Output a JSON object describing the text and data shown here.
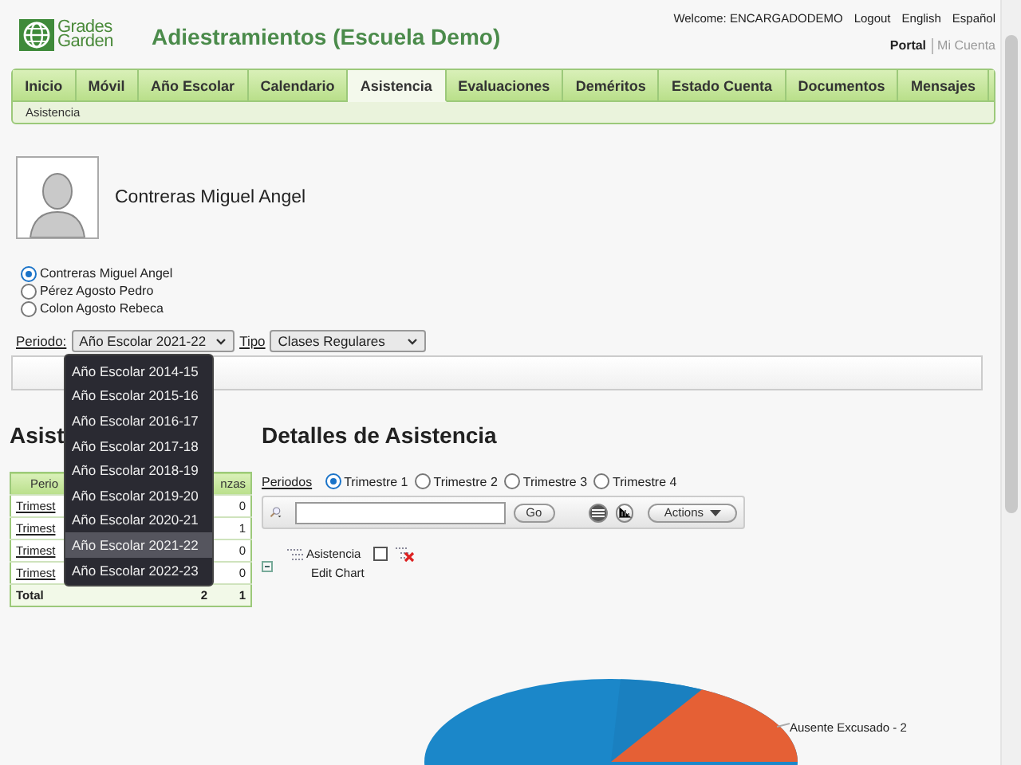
{
  "header": {
    "logo_text": [
      "Grades",
      "Garden"
    ],
    "title": "Adiestramientos (Escuela Demo)",
    "welcome": "Welcome: ENCARGADODEMO",
    "links": [
      "Logout",
      "English",
      "Español"
    ],
    "portal": [
      {
        "label": "Portal",
        "selected": true
      },
      {
        "label": "Mi Cuenta",
        "selected": false
      }
    ]
  },
  "tabs": [
    {
      "label": "Inicio",
      "selected": false
    },
    {
      "label": "Móvil",
      "selected": false
    },
    {
      "label": "Año Escolar",
      "selected": false
    },
    {
      "label": "Calendario",
      "selected": false
    },
    {
      "label": "Asistencia",
      "selected": true
    },
    {
      "label": "Evaluaciones",
      "selected": false
    },
    {
      "label": "Deméritos",
      "selected": false
    },
    {
      "label": "Estado Cuenta",
      "selected": false
    },
    {
      "label": "Documentos",
      "selected": false
    },
    {
      "label": "Mensajes",
      "selected": false
    }
  ],
  "breadcrumb": "Asistencia",
  "student": {
    "name": "Contreras Miguel Angel"
  },
  "students": [
    {
      "label": "Contreras Miguel Angel",
      "selected": true
    },
    {
      "label": "Pérez Agosto Pedro",
      "selected": false
    },
    {
      "label": "Colon Agosto Rebeca",
      "selected": false
    }
  ],
  "filters": {
    "period_label": "Periodo:",
    "period_value": "Año Escolar 2021-22",
    "type_label": "Tipo",
    "type_value": "Clases Regulares"
  },
  "period_menu": [
    {
      "label": "Año Escolar 2014-15",
      "selected": false
    },
    {
      "label": "Año Escolar 2015-16",
      "selected": false
    },
    {
      "label": "Año Escolar 2016-17",
      "selected": false
    },
    {
      "label": "Año Escolar 2017-18",
      "selected": false
    },
    {
      "label": "Año Escolar 2018-19",
      "selected": false
    },
    {
      "label": "Año Escolar 2019-20",
      "selected": false
    },
    {
      "label": "Año Escolar 2020-21",
      "selected": false
    },
    {
      "label": "Año Escolar 2021-22",
      "selected": true
    },
    {
      "label": "Año Escolar 2022-23",
      "selected": false
    }
  ],
  "summary": {
    "title": "Asist",
    "columns": [
      "Perio",
      "nzas"
    ],
    "rows": [
      {
        "column_1": "Trimest",
        "column_3": "0"
      },
      {
        "column_1": "Trimest",
        "column_3": "1"
      },
      {
        "column_1": "Trimest",
        "column_3": "0"
      },
      {
        "column_1": "Trimest",
        "column_3": "0"
      }
    ],
    "total": {
      "label": "Total",
      "column_2": "2",
      "column_3": "1"
    }
  },
  "details": {
    "title": "Detalles de Asistencia",
    "periods_label": "Periodos",
    "periods": [
      {
        "label": "Trimestre 1",
        "selected": true
      },
      {
        "label": "Trimestre 2",
        "selected": false
      },
      {
        "label": "Trimestre 3",
        "selected": false
      },
      {
        "label": "Trimestre 4",
        "selected": false
      }
    ],
    "go": "Go",
    "actions": "Actions",
    "views": [
      {
        "kind": "list",
        "selected": true
      },
      {
        "kind": "chart",
        "selected": false
      }
    ],
    "tree": {
      "label": "Asistencia",
      "checked": false,
      "expanded": true,
      "edit_link": "Edit Chart"
    },
    "chart_label": "Ausente Excusado - 2"
  }
}
